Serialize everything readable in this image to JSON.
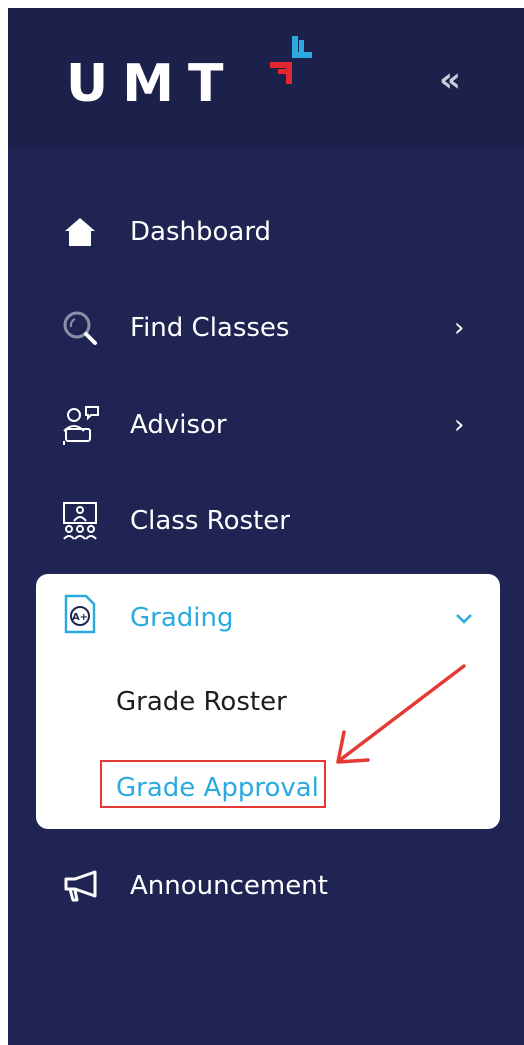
{
  "brand": {
    "logo_text": "UMT",
    "collapse_glyph": "«"
  },
  "colors": {
    "sidebar_bg": "#1f2453",
    "logo_band_bg": "#1c214c",
    "active_text": "#2aaae1",
    "annotation_red": "#e53935",
    "logo_mark_red": "#e4262e",
    "logo_mark_blue": "#2aaae1"
  },
  "nav": {
    "items": [
      {
        "label": "Dashboard",
        "icon": "home-icon",
        "has_submenu": false
      },
      {
        "label": "Find Classes",
        "icon": "search-icon",
        "has_submenu": true,
        "chevron": "›"
      },
      {
        "label": "Advisor",
        "icon": "advisor-icon",
        "has_submenu": true,
        "chevron": "›"
      },
      {
        "label": "Class Roster",
        "icon": "class-roster-icon",
        "has_submenu": false
      }
    ],
    "grading": {
      "label": "Grading",
      "icon": "grade-a-plus-icon",
      "expanded": true,
      "sub_items": [
        {
          "label": "Grade Roster",
          "active": false
        },
        {
          "label": "Grade Approval",
          "active": true
        }
      ]
    },
    "announcement": {
      "label": "Announcement",
      "icon": "megaphone-icon"
    }
  },
  "annotation": {
    "type": "arrow-and-box",
    "target": "Grade Approval"
  }
}
